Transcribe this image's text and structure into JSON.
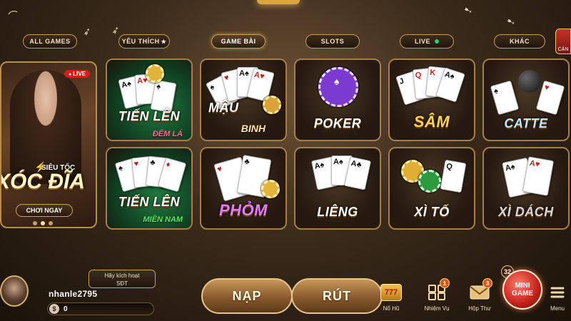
{
  "tabs": [
    {
      "label": "ALL GAMES"
    },
    {
      "label": "YÊU THÍCH"
    },
    {
      "label": "GAME BÀI"
    },
    {
      "label": "SLOTS"
    },
    {
      "label": "LIVE"
    },
    {
      "label": "KHÁC"
    }
  ],
  "corner_label": "CÁN",
  "featured": {
    "live_label": "LIVE",
    "subtitle": "SIÊU TỐC",
    "title": "XÓC ĐĨA",
    "cta": "CHƠI NGAY"
  },
  "games": [
    {
      "title": "TIẾN LÊN",
      "subtitle": "ĐẾM LÁ"
    },
    {
      "title": "MẬU",
      "subtitle": "BINH"
    },
    {
      "title": "POKER"
    },
    {
      "title": "SÂM"
    },
    {
      "title": "CATTE"
    },
    {
      "title": "TIẾN LÊN",
      "subtitle": "MIỀN NAM"
    },
    {
      "title": "PHỎM"
    },
    {
      "title": "LIÊNG"
    },
    {
      "title": "XÌ TỐ"
    },
    {
      "title": "XÌ DÁCH"
    }
  ],
  "user": {
    "activate_line1": "Hãy kích hoạt",
    "activate_line2": "SĐT",
    "username": "nhanle2795",
    "currency_symbol": "$",
    "balance": "0"
  },
  "actions": {
    "deposit": "NẠP",
    "withdraw": "RÚT"
  },
  "utilities": [
    {
      "label": "Nổ Hũ",
      "icon": "slot-777-icon"
    },
    {
      "label": "Nhiệm Vụ",
      "icon": "tasks-grid-icon",
      "badge": "1"
    },
    {
      "label": "Hộp Thư",
      "icon": "mail-icon",
      "badge": "3"
    },
    {
      "label": "Menu",
      "icon": "menu-icon"
    }
  ],
  "mini_game": {
    "count": "32",
    "line1": "MINI",
    "line2": "GAME"
  },
  "colors": {
    "accent_gold": "#c89b55",
    "live_red": "#d51d1d",
    "online_green": "#2ad16a"
  }
}
